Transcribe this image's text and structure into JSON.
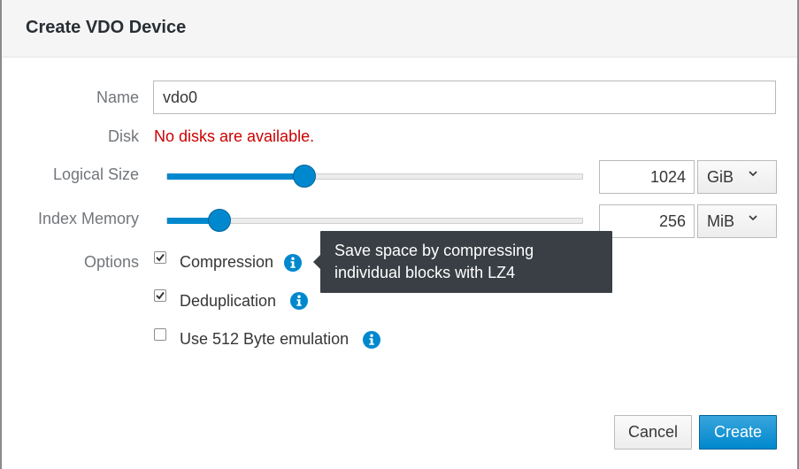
{
  "dialog": {
    "title": "Create VDO Device"
  },
  "form": {
    "name": {
      "label": "Name",
      "value": "vdo0"
    },
    "disk": {
      "label": "Disk",
      "error": "No disks are available."
    },
    "logical_size": {
      "label": "Logical Size",
      "value": "1024",
      "unit": "GiB",
      "slider_fraction": 0.33
    },
    "index_memory": {
      "label": "Index Memory",
      "value": "256",
      "unit": "MiB",
      "slider_fraction": 0.125
    },
    "options": {
      "label": "Options",
      "items": [
        {
          "label": "Compression",
          "checked": true
        },
        {
          "label": "Deduplication",
          "checked": true
        },
        {
          "label": "Use 512 Byte emulation",
          "checked": false
        }
      ]
    }
  },
  "tooltip": {
    "line1": "Save space by compressing",
    "line2": "individual blocks with LZ4"
  },
  "buttons": {
    "cancel": "Cancel",
    "create": "Create"
  },
  "colors": {
    "accent": "#0088ce",
    "error": "#cc0000",
    "tooltip_bg": "#393f44"
  },
  "icons": {
    "info": "info-circle-icon",
    "caret": "chevron-down-icon",
    "check": "checkmark-icon"
  }
}
